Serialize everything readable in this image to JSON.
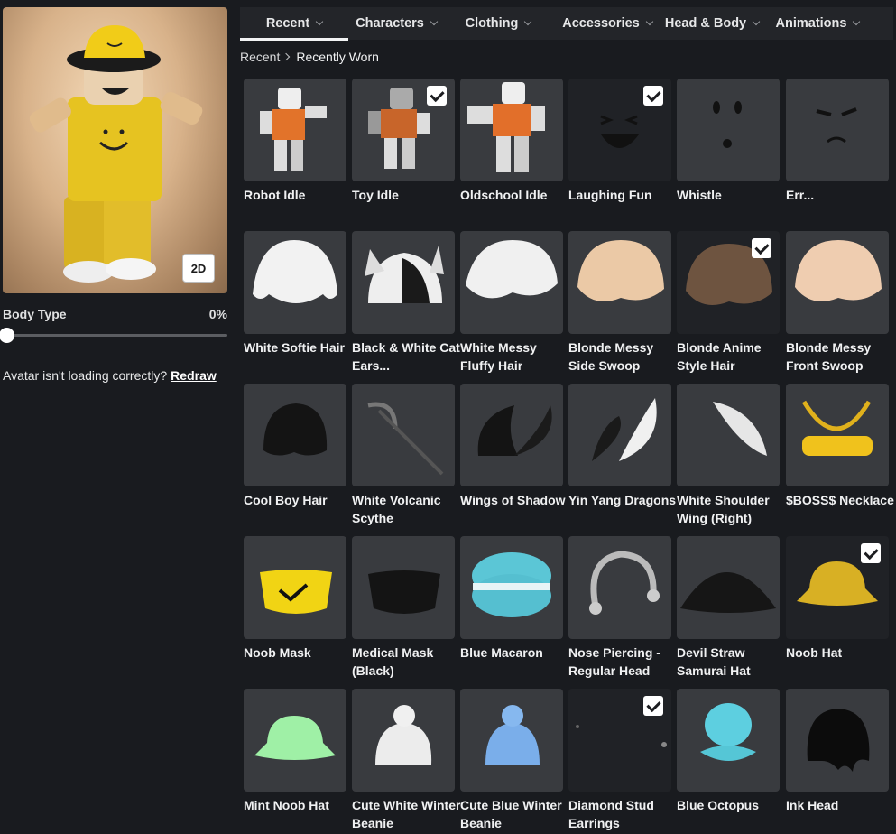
{
  "left": {
    "view_toggle": "2D",
    "body_type_label": "Body Type",
    "body_type_value": "0%",
    "body_type_fraction": 0,
    "redraw_prompt": "Avatar isn't loading correctly?",
    "redraw_link": "Redraw"
  },
  "tabs": [
    {
      "label": "Recent",
      "active": true
    },
    {
      "label": "Characters",
      "active": false
    },
    {
      "label": "Clothing",
      "active": false
    },
    {
      "label": "Accessories",
      "active": false
    },
    {
      "label": "Head & Body",
      "active": false
    },
    {
      "label": "Animations",
      "active": false
    }
  ],
  "breadcrumb": {
    "root": "Recent",
    "current": "Recently Worn"
  },
  "items": [
    {
      "name": "Robot Idle",
      "icon": "robot-idle-icon",
      "checked": false
    },
    {
      "name": "Toy Idle",
      "icon": "toy-idle-icon",
      "checked": true
    },
    {
      "name": "Oldschool Idle",
      "icon": "oldschool-idle-icon",
      "checked": false
    },
    {
      "name": "Laughing Fun",
      "icon": "laughing-face-icon",
      "checked": true
    },
    {
      "name": "Whistle",
      "icon": "whistle-face-icon",
      "checked": false
    },
    {
      "name": "Err...",
      "icon": "err-face-icon",
      "checked": false
    },
    {
      "name": "White Softie Hair",
      "icon": "white-hair-icon",
      "checked": false
    },
    {
      "name": "Black & White Cat Ears...",
      "icon": "cat-ears-icon",
      "checked": false
    },
    {
      "name": "White Messy Fluffy Hair",
      "icon": "white-messy-hair-icon",
      "checked": false
    },
    {
      "name": "Blonde Messy Side Swoop",
      "icon": "blonde-hair-icon",
      "checked": false
    },
    {
      "name": "Blonde Anime Style Hair",
      "icon": "brown-hair-icon",
      "checked": true
    },
    {
      "name": "Blonde Messy Front Swoop",
      "icon": "blonde-front-hair-icon",
      "checked": false
    },
    {
      "name": "Cool Boy Hair",
      "icon": "black-hair-icon",
      "checked": false
    },
    {
      "name": "White Volcanic Scythe",
      "icon": "scythe-icon",
      "checked": false
    },
    {
      "name": "Wings of Shadow",
      "icon": "shadow-wings-icon",
      "checked": false
    },
    {
      "name": "Yin Yang Dragons",
      "icon": "dragons-icon",
      "checked": false
    },
    {
      "name": "White Shoulder Wing (Right)",
      "icon": "white-wing-icon",
      "checked": false
    },
    {
      "name": "$BOSS$ Necklace",
      "icon": "boss-necklace-icon",
      "checked": false
    },
    {
      "name": "Noob Mask",
      "icon": "noob-mask-icon",
      "checked": false
    },
    {
      "name": "Medical Mask (Black)",
      "icon": "black-mask-icon",
      "checked": false
    },
    {
      "name": "Blue Macaron",
      "icon": "macaron-icon",
      "checked": false
    },
    {
      "name": "Nose Piercing - Regular Head",
      "icon": "nose-piercing-icon",
      "checked": false
    },
    {
      "name": "Devil Straw Samurai Hat",
      "icon": "samurai-hat-icon",
      "checked": false
    },
    {
      "name": "Noob Hat",
      "icon": "noob-hat-icon",
      "checked": true
    },
    {
      "name": "Mint Noob Hat",
      "icon": "mint-hat-icon",
      "checked": false
    },
    {
      "name": "Cute White Winter Beanie",
      "icon": "white-beanie-icon",
      "checked": false
    },
    {
      "name": "Cute Blue Winter Beanie",
      "icon": "blue-beanie-icon",
      "checked": false
    },
    {
      "name": "Diamond Stud Earrings",
      "icon": "stud-earrings-icon",
      "checked": true
    },
    {
      "name": "Blue Octopus",
      "icon": "octopus-icon",
      "checked": false
    },
    {
      "name": "Ink Head",
      "icon": "ink-head-icon",
      "checked": false
    }
  ],
  "colors": {
    "background": "#191b1f",
    "tile": "#393b3f",
    "tab_bar": "#232529",
    "accent": "#f2f3f4"
  }
}
